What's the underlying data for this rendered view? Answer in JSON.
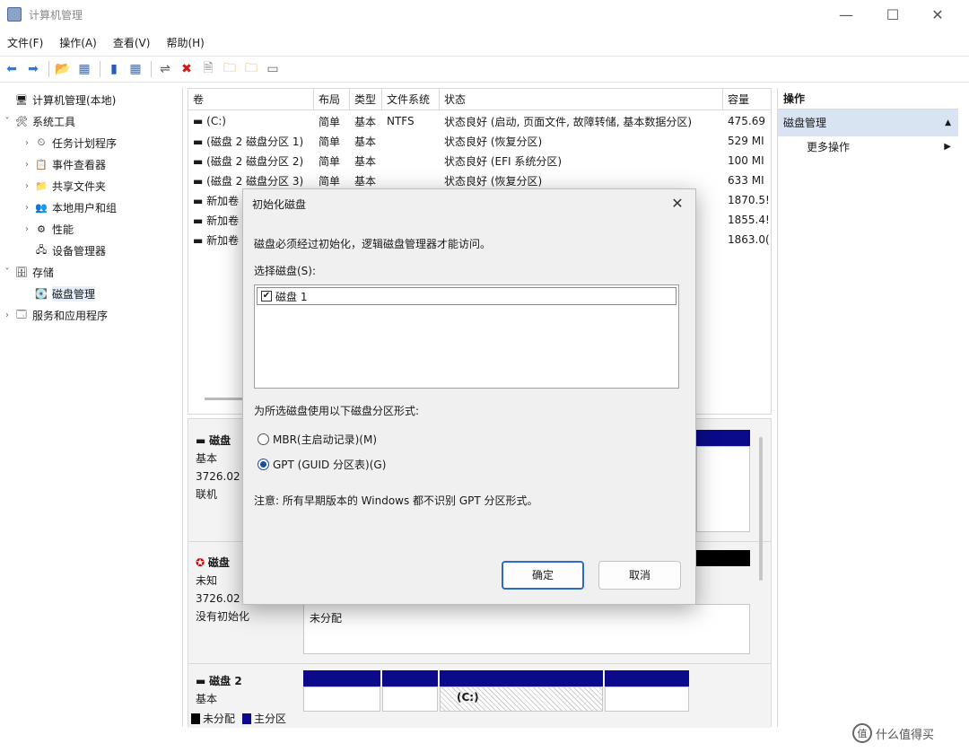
{
  "window": {
    "title": "计算机管理",
    "minimize": "—",
    "maximize": "☐",
    "close": "✕"
  },
  "menu": [
    "文件(F)",
    "操作(A)",
    "查看(V)",
    "帮助(H)"
  ],
  "toolbar": {
    "icons": [
      "back-icon",
      "forward-icon",
      "up-folder-icon",
      "show-hide-tree-icon",
      "properties-icon",
      "help-icon",
      "connect-icon",
      "delete-icon",
      "new-icon",
      "refresh-icon",
      "export-icon",
      "view-icon"
    ]
  },
  "tree": [
    {
      "label": "计算机管理(本地)",
      "chev": "",
      "icon": "🖥"
    },
    {
      "label": "系统工具",
      "chev": "˅",
      "icon": "🛠"
    },
    {
      "label": "任务计划程序",
      "chev": "›",
      "icon": "⏲"
    },
    {
      "label": "事件查看器",
      "chev": "›",
      "icon": "📋"
    },
    {
      "label": "共享文件夹",
      "chev": "›",
      "icon": "📁"
    },
    {
      "label": "本地用户和组",
      "chev": "›",
      "icon": "👥"
    },
    {
      "label": "性能",
      "chev": "›",
      "icon": "⚙"
    },
    {
      "label": "设备管理器",
      "chev": "",
      "icon": "🖧"
    },
    {
      "label": "存储",
      "chev": "˅",
      "icon": "🗄"
    },
    {
      "label": "磁盘管理",
      "chev": "",
      "icon": "💽"
    },
    {
      "label": "服务和应用程序",
      "chev": "›",
      "icon": "🗔"
    }
  ],
  "volumes": {
    "headers": [
      "卷",
      "布局",
      "类型",
      "文件系统",
      "状态",
      "容量"
    ],
    "rows": [
      [
        "(C:)",
        "简单",
        "基本",
        "NTFS",
        "状态良好 (启动, 页面文件, 故障转储, 基本数据分区)",
        "475.69"
      ],
      [
        "(磁盘 2 磁盘分区 1)",
        "简单",
        "基本",
        "",
        "状态良好 (恢复分区)",
        "529 MI"
      ],
      [
        "(磁盘 2 磁盘分区 2)",
        "简单",
        "基本",
        "",
        "状态良好 (EFI 系统分区)",
        "100 MI"
      ],
      [
        "(磁盘 2 磁盘分区 3)",
        "简单",
        "基本",
        "",
        "状态良好 (恢复分区)",
        "633 MI"
      ],
      [
        "新加卷",
        "",
        "",
        "",
        "",
        "1870.5!"
      ],
      [
        "新加卷",
        "",
        "",
        "",
        "",
        "1855.4!"
      ],
      [
        "新加卷",
        "",
        "",
        "",
        "",
        "1863.0("
      ]
    ]
  },
  "disks": [
    {
      "name": "磁盘",
      "l1": "基本",
      "l2": "3726.02",
      "l3": "联机"
    },
    {
      "name": "磁盘",
      "l1": "未知",
      "l2": "3726.02",
      "l3": "没有初始化",
      "unalloc": "未分配"
    },
    {
      "name": "磁盘 2",
      "l1": "基本",
      "c_label": "(C:)"
    }
  ],
  "legend": {
    "unallocated": "未分配",
    "primary": "主分区"
  },
  "actions": {
    "header": "操作",
    "section": "磁盘管理",
    "more": "更多操作"
  },
  "dialog": {
    "title": "初始化磁盘",
    "intro": "磁盘必须经过初始化，逻辑磁盘管理器才能访问。",
    "select_label": "选择磁盘(S):",
    "disk_entry": "磁盘 1",
    "style_label": "为所选磁盘使用以下磁盘分区形式:",
    "mbr": "MBR(主启动记录)(M)",
    "gpt": "GPT (GUID 分区表)(G)",
    "note": "注意: 所有早期版本的 Windows 都不识别 GPT 分区形式。",
    "ok": "确定",
    "cancel": "取消"
  },
  "watermark": {
    "text": "什么值得买",
    "logo": "值"
  },
  "colors": {
    "partition_bar": "#0a0a8a",
    "unallocated": "#000000",
    "selection": "#d8e4f2",
    "accent": "#2d6bc8"
  }
}
